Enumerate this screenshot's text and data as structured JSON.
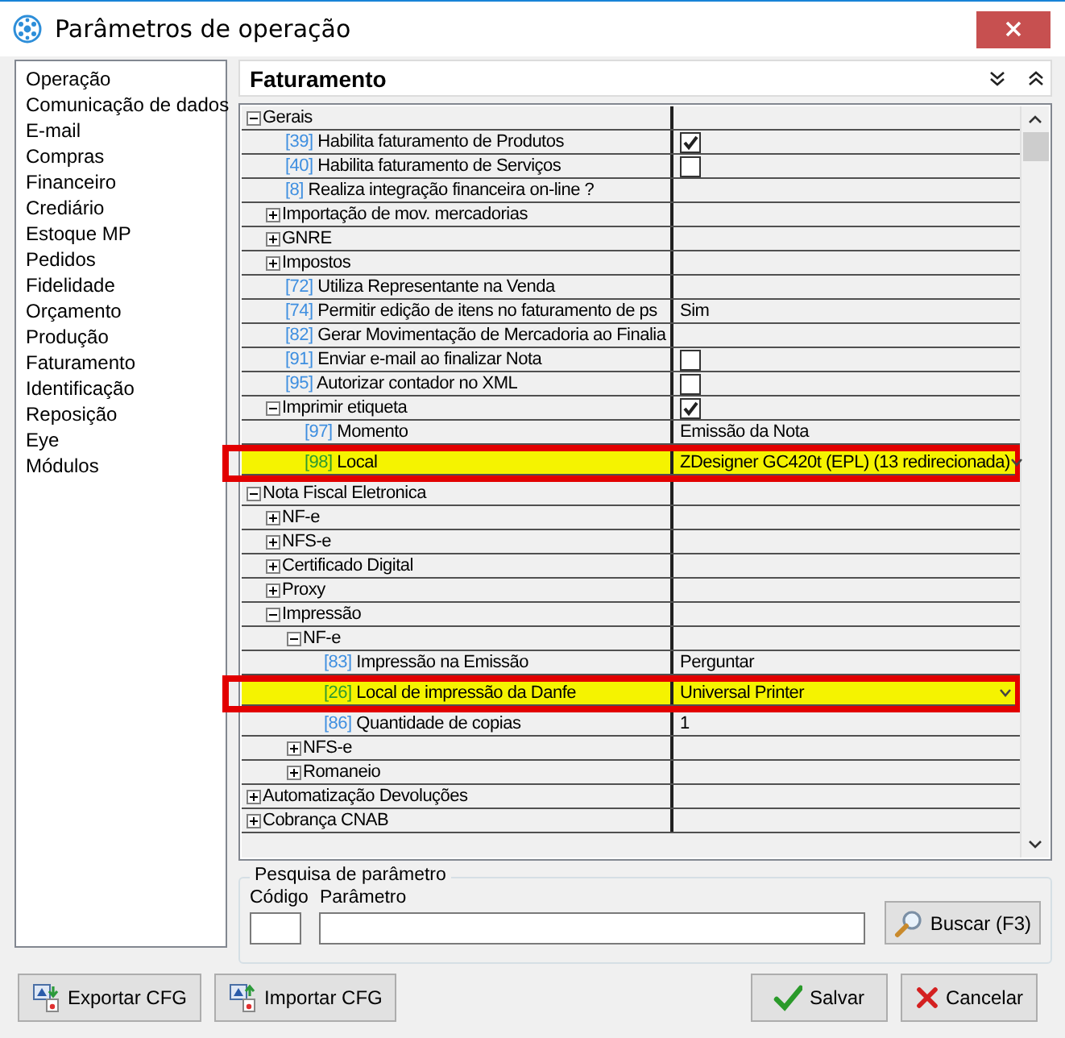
{
  "window": {
    "title": "Parâmetros de operação"
  },
  "sidebar": {
    "items": [
      "Operação",
      "Comunicação de dados",
      "E-mail",
      "Compras",
      "Financeiro",
      "Crediário",
      "Estoque MP",
      "Pedidos",
      "Fidelidade",
      "Orçamento",
      "Produção",
      "Faturamento",
      "Identificação",
      "Reposição",
      "Eye",
      "Módulos"
    ]
  },
  "panel": {
    "title": "Faturamento"
  },
  "tree": [
    {
      "kind": "group",
      "label": "Gerais",
      "expanded": true,
      "highlighted": false,
      "children": [
        {
          "kind": "check",
          "code": "[39]",
          "label": "Habilita faturamento de Produtos",
          "checked": true,
          "highlighted": false
        },
        {
          "kind": "check",
          "code": "[40]",
          "label": "Habilita faturamento de Serviços",
          "checked": false,
          "highlighted": false
        },
        {
          "kind": "param",
          "code": "[8]",
          "label": "Realiza integração financeira on-line ?",
          "highlighted": false
        },
        {
          "kind": "group",
          "label": "Importação de mov. mercadorias",
          "expanded": false,
          "highlighted": false
        },
        {
          "kind": "group",
          "label": "GNRE",
          "expanded": false,
          "highlighted": false
        },
        {
          "kind": "group",
          "label": "Impostos",
          "expanded": false,
          "highlighted": false
        },
        {
          "kind": "param",
          "code": "[72]",
          "label": "Utiliza Representante na Venda",
          "highlighted": false
        },
        {
          "kind": "param",
          "code": "[74]",
          "label": "Permitir edição de itens no faturamento de ps",
          "value": "Sim",
          "highlighted": false
        },
        {
          "kind": "param",
          "code": "[82]",
          "label": "Gerar Movimentação de Mercadoria ao Finalia",
          "highlighted": false
        },
        {
          "kind": "check",
          "code": "[91]",
          "label": "Enviar e-mail ao finalizar Nota",
          "checked": false,
          "highlighted": false
        },
        {
          "kind": "check",
          "code": "[95]",
          "label": "Autorizar contador no XML",
          "checked": false,
          "highlighted": false
        },
        {
          "kind": "group",
          "label": "Imprimir etiqueta",
          "expanded": true,
          "checked": true,
          "highlighted": false,
          "children": [
            {
              "kind": "param",
              "code": "[97]",
              "label": "Momento",
              "value": "Emissão da Nota",
              "highlighted": false
            },
            {
              "kind": "select",
              "code": "[98]",
              "label": "Local",
              "value": "ZDesigner GC420t (EPL) (13 redirecionada)",
              "highlighted": true
            }
          ]
        }
      ]
    },
    {
      "kind": "group",
      "label": "Nota Fiscal Eletronica",
      "expanded": true,
      "highlighted": false,
      "children": [
        {
          "kind": "group",
          "label": "NF-e",
          "expanded": false,
          "highlighted": false
        },
        {
          "kind": "group",
          "label": "NFS-e",
          "expanded": false,
          "highlighted": false
        },
        {
          "kind": "group",
          "label": "Certificado Digital",
          "expanded": false,
          "highlighted": false
        },
        {
          "kind": "group",
          "label": "Proxy",
          "expanded": false,
          "highlighted": false
        },
        {
          "kind": "group",
          "label": "Impressão",
          "expanded": true,
          "highlighted": false,
          "children": [
            {
              "kind": "group",
              "label": "NF-e",
              "expanded": true,
              "highlighted": false,
              "children": [
                {
                  "kind": "param",
                  "code": "[83]",
                  "label": "Impressão na Emissão",
                  "value": "Perguntar",
                  "highlighted": false
                },
                {
                  "kind": "select",
                  "code": "[26]",
                  "label": "Local de impressão da Danfe",
                  "value": "Universal Printer",
                  "highlighted": true
                },
                {
                  "kind": "param",
                  "code": "[86]",
                  "label": "Quantidade de copias",
                  "value": "1",
                  "highlighted": false
                }
              ]
            },
            {
              "kind": "group",
              "label": "NFS-e",
              "expanded": false,
              "highlighted": false
            },
            {
              "kind": "group",
              "label": "Romaneio",
              "expanded": false,
              "highlighted": false
            }
          ]
        }
      ]
    },
    {
      "kind": "group",
      "label": "Automatização Devoluções",
      "expanded": false,
      "highlighted": false
    },
    {
      "kind": "group",
      "label": "Cobrança CNAB",
      "expanded": false,
      "highlighted": false
    }
  ],
  "search": {
    "title": "Pesquisa de parâmetro",
    "code_label": "Código",
    "param_label": "Parâmetro",
    "button": "Buscar (F3)"
  },
  "footer": {
    "left_buttons": [
      {
        "label": "Exportar CFG",
        "kind": "export"
      },
      {
        "label": "Importar CFG",
        "kind": "import"
      }
    ],
    "right_buttons": [
      {
        "label": "Salvar",
        "kind": "save"
      },
      {
        "label": "Cancelar",
        "kind": "cancel"
      }
    ]
  }
}
